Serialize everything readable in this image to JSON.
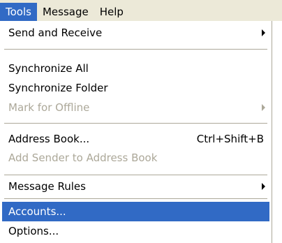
{
  "menubar": {
    "items": [
      "Tools",
      "Message",
      "Help"
    ]
  },
  "menu": {
    "send_receive": "Send and Receive",
    "synchronize_all": "Synchronize All",
    "synchronize_folder": "Synchronize Folder",
    "mark_offline": "Mark for Offline",
    "address_book": "Address Book...",
    "address_book_shortcut": "Ctrl+Shift+B",
    "add_sender": "Add Sender to Address Book",
    "message_rules": "Message Rules",
    "accounts": "Accounts...",
    "options": "Options..."
  },
  "colors": {
    "highlight": "#316ac5",
    "menubar_bg": "#ece9d8",
    "disabled_text": "#aca899"
  }
}
